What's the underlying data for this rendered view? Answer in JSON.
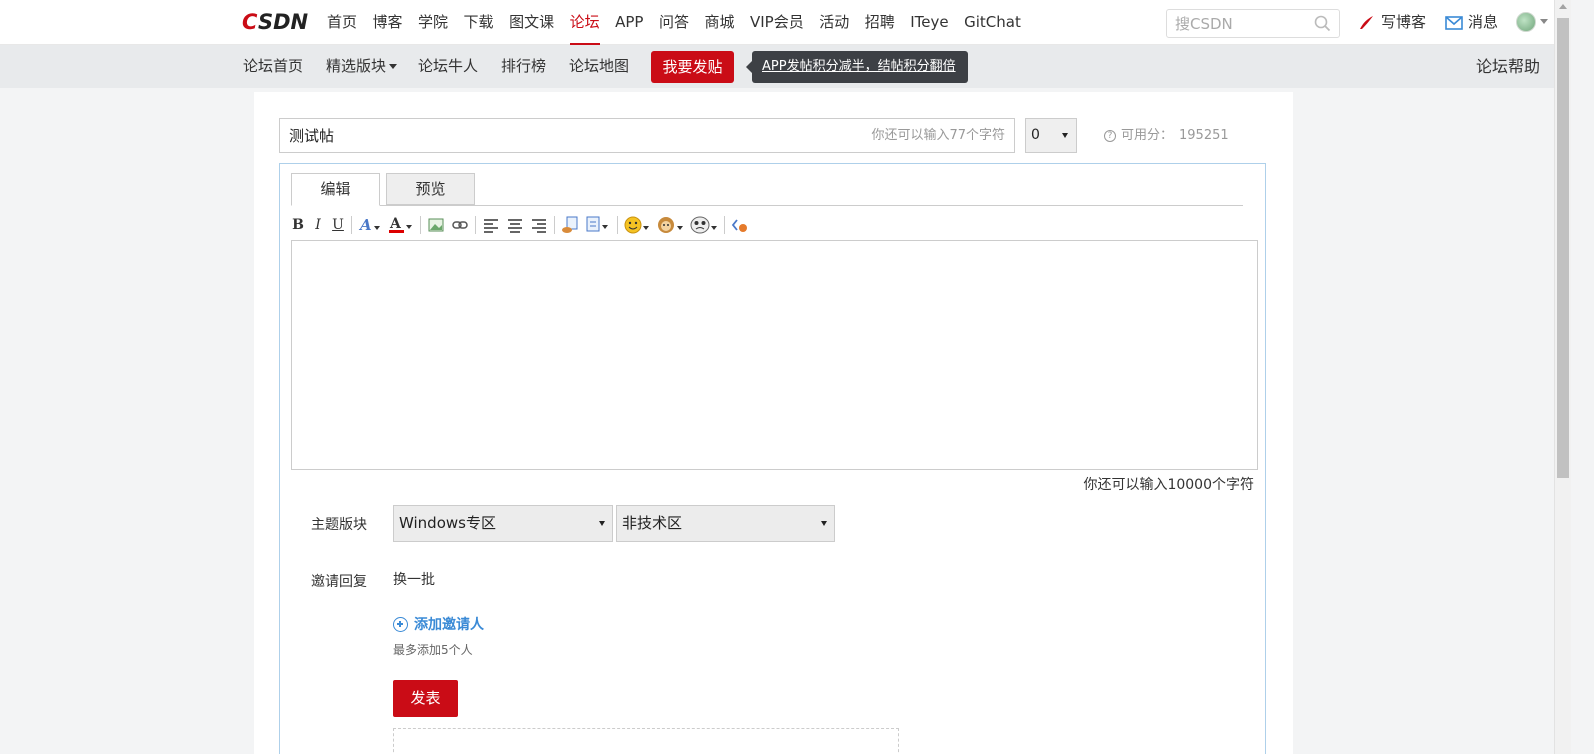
{
  "header": {
    "logo_text": "CSDN",
    "nav": [
      "首页",
      "博客",
      "学院",
      "下载",
      "图文课",
      "论坛",
      "APP",
      "问答",
      "商城",
      "VIP会员",
      "活动",
      "招聘",
      "ITeye",
      "GitChat"
    ],
    "active_nav": "论坛",
    "search_placeholder": "搜CSDN",
    "write_blog": "写博客",
    "messages": "消息"
  },
  "subnav": {
    "home": "论坛首页",
    "featured": "精选版块",
    "experts": "论坛牛人",
    "ranking": "排行榜",
    "map": "论坛地图",
    "post_button": "我要发贴",
    "tip": "APP发帖积分减半，结帖积分翻倍",
    "help": "论坛帮助"
  },
  "form": {
    "title_value": "测试帖",
    "title_remaining": "你还可以输入77个字符",
    "score_value": "0",
    "usable_label": "可用分：",
    "usable_value": "195251",
    "tabs": [
      "编辑",
      "预览"
    ],
    "body_remaining": "你还可以输入10000个字符",
    "board_label": "主题版块",
    "board_primary": "Windows专区",
    "board_secondary": "非技术区",
    "invite_label": "邀请回复",
    "refresh": "换一批",
    "add_invitee": "添加邀请人",
    "max_invitees": "最多添加5个人",
    "submit": "发表"
  },
  "colors": {
    "brand_red": "#ca0c16",
    "link_blue": "#3a8ad6",
    "editor_border": "#aed0ea"
  }
}
